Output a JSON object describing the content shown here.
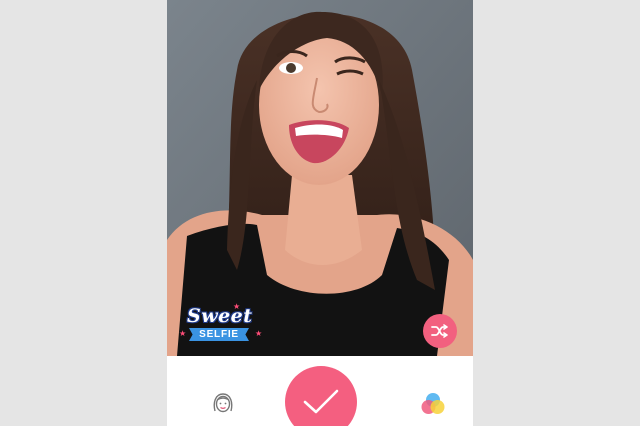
{
  "sticker": {
    "title": "Sweet",
    "subtitle": "SELFIE"
  },
  "icons": {
    "shuffle": "shuffle-icon",
    "face": "face-icon",
    "confirm": "checkmark-icon",
    "filter": "color-filter-icon"
  },
  "colors": {
    "accent": "#f45f80",
    "shuffle_bg": "#f2607f",
    "ribbon": "#3a93e2"
  }
}
